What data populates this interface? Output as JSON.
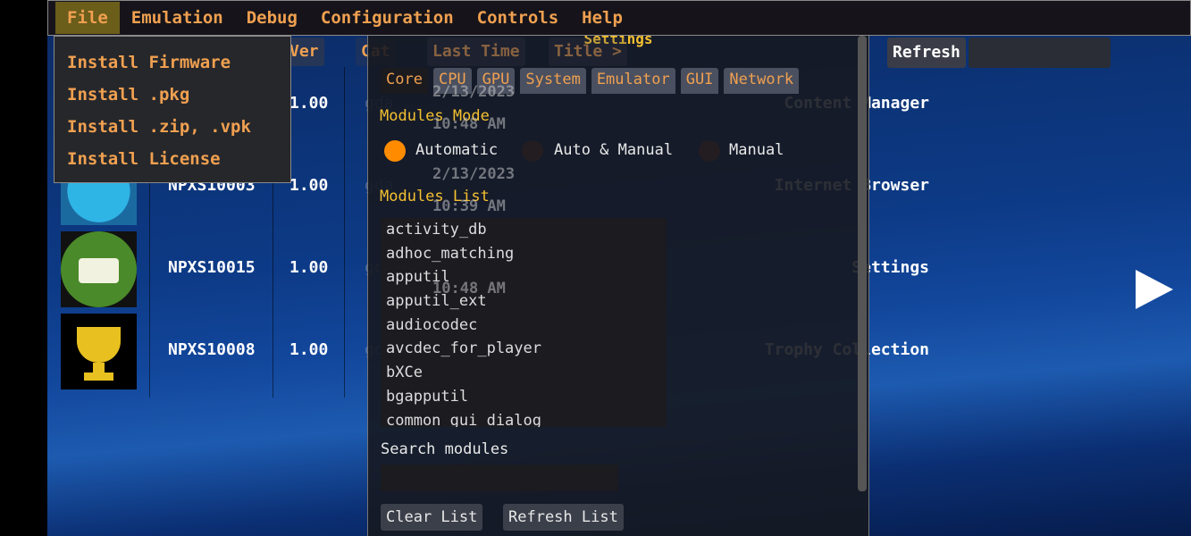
{
  "menubar": {
    "items": [
      "File",
      "Emulation",
      "Debug",
      "Configuration",
      "Controls",
      "Help"
    ],
    "active": "File"
  },
  "file_menu": [
    "Install Firmware",
    "Install .pkg",
    "Install .zip, .vpk",
    "Install License"
  ],
  "list_headers": {
    "ver": "Ver",
    "cat": "Cat",
    "last_time": "Last Time",
    "title": "Title >"
  },
  "refresh_label": "Refresh",
  "games": [
    {
      "id": "",
      "ver": "1.00",
      "cat": "gda",
      "date": "2/13/2023",
      "time": "10:48 AM",
      "title": "Content Manager",
      "icon": "content-manager-icon"
    },
    {
      "id": "NPXS10003",
      "ver": "1.00",
      "cat": "gda",
      "date": "2/13/2023",
      "time": "10:39 AM",
      "title": "Internet Browser",
      "icon": "browser-icon"
    },
    {
      "id": "NPXS10015",
      "ver": "1.00",
      "cat": "gda",
      "date": "",
      "time": "10:48 AM",
      "title": "Settings",
      "icon": "toolbox-icon"
    },
    {
      "id": "NPXS10008",
      "ver": "1.00",
      "cat": "gda",
      "date": "",
      "time": "",
      "title": "Trophy Collection",
      "icon": "trophy-icon"
    }
  ],
  "settings": {
    "title": "Settings",
    "tabs": [
      "Core",
      "CPU",
      "GPU",
      "System",
      "Emulator",
      "GUI",
      "Network"
    ],
    "active_tab": "Core",
    "modules_mode_label": "Modules Mode",
    "modes": [
      "Automatic",
      "Auto & Manual",
      "Manual"
    ],
    "selected_mode": "Automatic",
    "modules_list_label": "Modules List",
    "modules": [
      "activity_db",
      "adhoc_matching",
      "apputil",
      "apputil_ext",
      "audiocodec",
      "avcdec_for_player",
      "bXCe",
      "bgapputil",
      "common_gui_dialog"
    ],
    "search_label": "Search modules",
    "search_value": "",
    "clear_label": "Clear List",
    "refresh_list_label": "Refresh List"
  },
  "colors": {
    "accent": "#f0a050",
    "selected_radio": "#ff8c00",
    "section": "#f5c030"
  }
}
